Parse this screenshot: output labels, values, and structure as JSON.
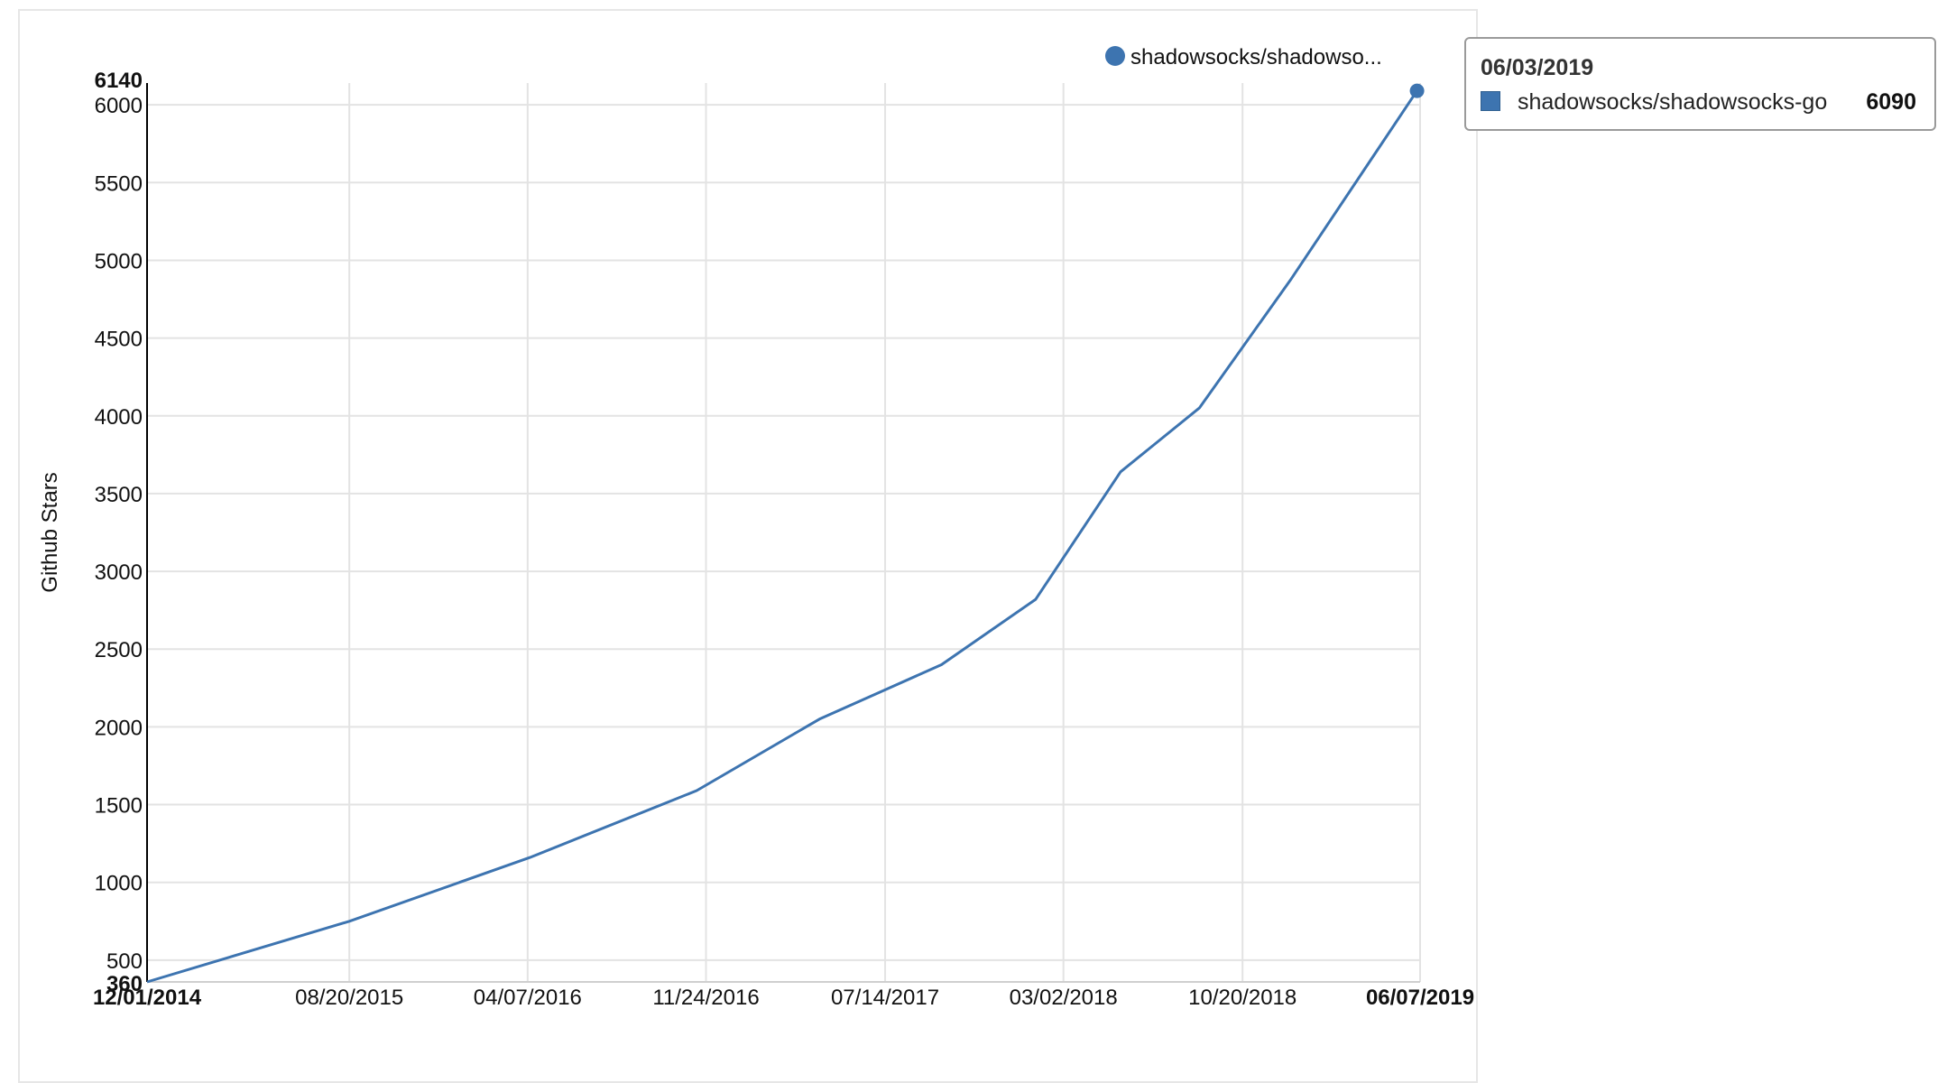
{
  "colors": {
    "series": "#3d74b0",
    "grid": "#e3e3e3",
    "axis": "#000000"
  },
  "legend": {
    "label": "shadowsocks/shadowso..."
  },
  "tooltip": {
    "date": "06/03/2019",
    "series": "shadowsocks/shadowsocks-go",
    "value": "6090"
  },
  "chart_data": {
    "type": "line",
    "ylabel": "Github Stars",
    "xlabel": "",
    "ylim": [
      360,
      6140
    ],
    "y_ticks": [
      500,
      1000,
      1500,
      2000,
      2500,
      3000,
      3500,
      4000,
      4500,
      5000,
      5500,
      6000
    ],
    "y_extent_labels": [
      "360",
      "6140"
    ],
    "x_range": [
      "12/01/2014",
      "06/07/2019"
    ],
    "x_ticks": [
      "08/20/2015",
      "04/07/2016",
      "11/24/2016",
      "07/14/2017",
      "03/02/2018",
      "10/20/2018"
    ],
    "x_extent_labels": [
      "12/01/2014",
      "06/07/2019"
    ],
    "legend_position": "top-right",
    "grid": true,
    "series": [
      {
        "name": "shadowsocks/shadowsocks-go",
        "x": [
          "12/01/2014",
          "08/20/2015",
          "04/10/2016",
          "11/12/2016",
          "04/20/2017",
          "09/25/2017",
          "01/25/2018",
          "05/15/2018",
          "08/25/2018",
          "12/22/2018",
          "06/03/2019"
        ],
        "y": [
          360,
          750,
          1160,
          1590,
          2050,
          2400,
          2820,
          3640,
          4050,
          4880,
          6090
        ]
      }
    ],
    "highlight": {
      "x": "06/03/2019",
      "y": 6090
    }
  }
}
